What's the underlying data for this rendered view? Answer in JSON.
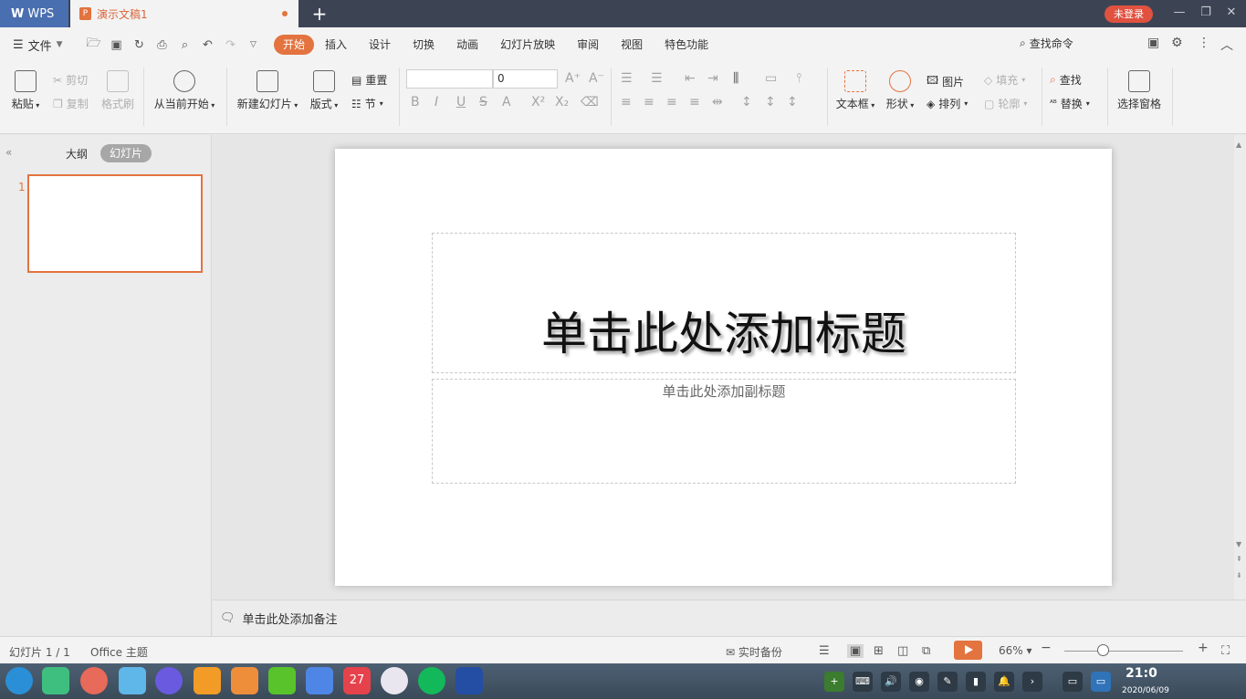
{
  "titlebar": {
    "app_tab": "WPS",
    "doc_tab": "演示文稿1",
    "login": "未登录"
  },
  "menu": {
    "file": "文件",
    "tabs": [
      "开始",
      "插入",
      "设计",
      "切换",
      "动画",
      "幻灯片放映",
      "审阅",
      "视图",
      "特色功能"
    ],
    "search": "查找命令"
  },
  "ribbon": {
    "paste": "粘贴",
    "cut": "剪切",
    "copy": "复制",
    "format_painter": "格式刷",
    "play_from_current": "从当前开始",
    "new_slide": "新建幻灯片",
    "layout": "版式",
    "reset": "重置",
    "section": "节",
    "font_size": "0",
    "textbox": "文本框",
    "shape": "形状",
    "picture": "图片",
    "arrange": "排列",
    "fill": "填充",
    "outline": "轮廓",
    "find": "查找",
    "replace": "替换",
    "selection_pane": "选择窗格"
  },
  "left_panel": {
    "outline_tab": "大纲",
    "slides_tab": "幻灯片",
    "thumb_number": "1"
  },
  "slide": {
    "title_placeholder": "单击此处添加标题",
    "subtitle_placeholder": "单击此处添加副标题"
  },
  "notes": {
    "placeholder": "单击此处添加备注"
  },
  "statusbar": {
    "slide_count": "幻灯片 1 / 1",
    "theme": "Office 主题",
    "backup": "实时备份",
    "zoom": "66%"
  },
  "taskbar": {
    "calendar_day": "27",
    "time": "21:0",
    "date": "2020/06/09"
  },
  "colors": {
    "accent": "#e3733f",
    "tabbar": "#3c4454",
    "wps_blue": "#4a6fb0"
  }
}
